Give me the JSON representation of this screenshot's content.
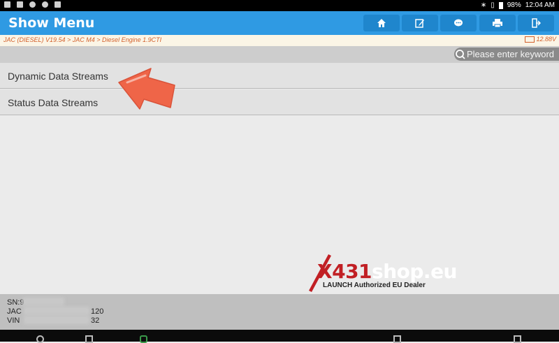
{
  "status_bar": {
    "battery": "98%",
    "time": "12:04 AM"
  },
  "header": {
    "title": "Show Menu",
    "buttons": [
      "home-icon",
      "edit-icon",
      "chat-icon",
      "print-icon",
      "exit-icon"
    ]
  },
  "breadcrumb": {
    "path": "JAC (DIESEL) V19.54 > JAC M4 > Diesel Engine 1.9CTI",
    "voltage": "12.88V"
  },
  "search": {
    "placeholder": "Please enter keyword"
  },
  "menu": {
    "items": [
      {
        "label": "Dynamic Data Streams"
      },
      {
        "label": "Status Data Streams"
      }
    ]
  },
  "watermark": {
    "brand_x": "X",
    "brand_num": "431",
    "brand_rest": "shop.eu",
    "tagline": "LAUNCH Authorized EU Dealer"
  },
  "footer": {
    "sn": "SN:9",
    "jac": "JAC",
    "jac_tail": "120",
    "vin": "VIN",
    "vin_tail": "32"
  },
  "colors": {
    "header_blue": "#2f9ae3",
    "button_blue": "#1f86cd",
    "breadcrumb_orange": "#d2602c",
    "arrow_red": "#ef6548"
  }
}
